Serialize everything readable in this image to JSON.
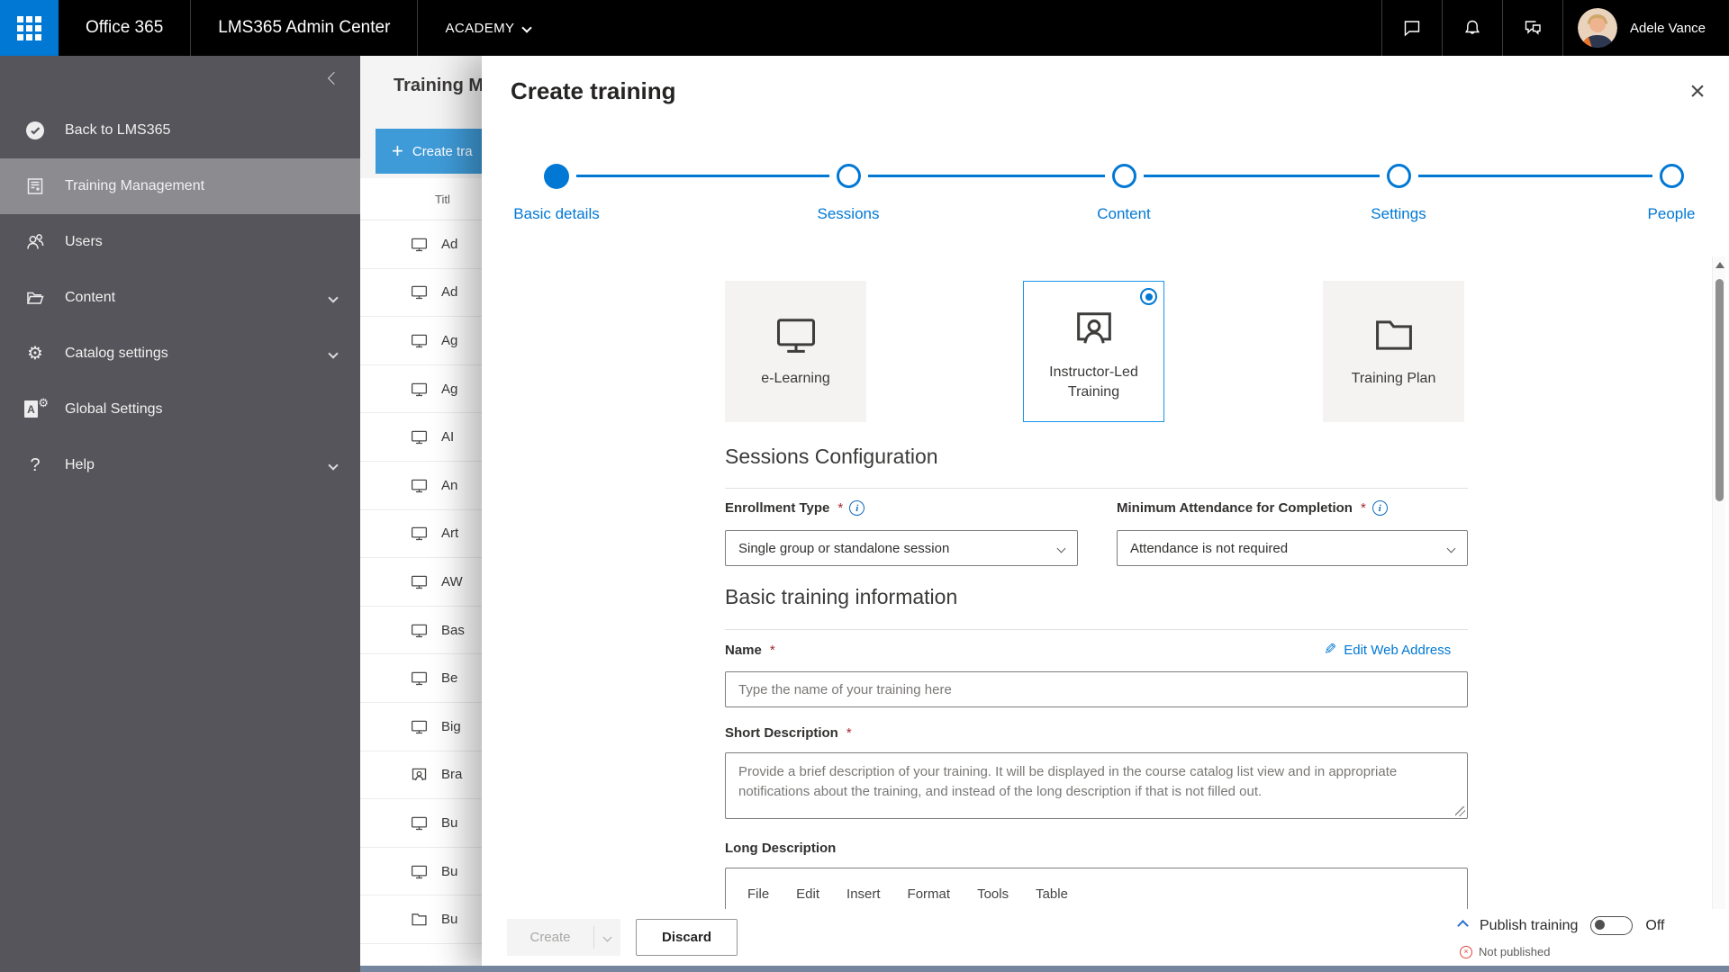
{
  "topbar": {
    "office365": "Office 365",
    "admin_center": "LMS365 Admin Center",
    "tenant": "ACADEMY",
    "user_name": "Adele Vance"
  },
  "sidebar": {
    "items": [
      {
        "label": "Back to LMS365",
        "icon": "check-circle",
        "selected": false,
        "expandable": false
      },
      {
        "label": "Training Management",
        "icon": "training-doc",
        "selected": true,
        "expandable": false
      },
      {
        "label": "Users",
        "icon": "users",
        "selected": false,
        "expandable": false
      },
      {
        "label": "Content",
        "icon": "folder",
        "selected": false,
        "expandable": true
      },
      {
        "label": "Catalog settings",
        "icon": "gear",
        "selected": false,
        "expandable": true
      },
      {
        "label": "Global Settings",
        "icon": "global-settings",
        "selected": false,
        "expandable": false
      },
      {
        "label": "Help",
        "icon": "question",
        "selected": false,
        "expandable": true
      }
    ]
  },
  "list_panel": {
    "title_fragment": "Training M",
    "create_button_fragment": "Create tra",
    "column_header_fragment": "Titl",
    "rows": [
      {
        "label": "Ad",
        "icon": "e-learning"
      },
      {
        "label": "Ad",
        "icon": "e-learning"
      },
      {
        "label": "Ag",
        "icon": "e-learning"
      },
      {
        "label": "Ag",
        "icon": "e-learning"
      },
      {
        "label": "AI",
        "icon": "e-learning"
      },
      {
        "label": "An",
        "icon": "e-learning"
      },
      {
        "label": "Art",
        "icon": "e-learning"
      },
      {
        "label": "AW",
        "icon": "e-learning"
      },
      {
        "label": "Bas",
        "icon": "e-learning"
      },
      {
        "label": "Be",
        "icon": "e-learning"
      },
      {
        "label": "Big",
        "icon": "e-learning"
      },
      {
        "label": "Bra",
        "icon": "instructor-led"
      },
      {
        "label": "Bu",
        "icon": "e-learning"
      },
      {
        "label": "Bu",
        "icon": "e-learning"
      },
      {
        "label": "Bu",
        "icon": "training-plan"
      }
    ]
  },
  "modal": {
    "title": "Create training",
    "steps": [
      {
        "label": "Basic details",
        "state": "active"
      },
      {
        "label": "Sessions",
        "state": "upcoming"
      },
      {
        "label": "Content",
        "state": "upcoming"
      },
      {
        "label": "Settings",
        "state": "upcoming"
      },
      {
        "label": "People",
        "state": "upcoming"
      }
    ],
    "training_types": [
      {
        "label": "e-Learning",
        "icon": "monitor",
        "selected": false
      },
      {
        "label": "Instructor-Led Training",
        "icon": "instructor",
        "selected": true
      },
      {
        "label": "Training Plan",
        "icon": "folder",
        "selected": false
      }
    ],
    "sessions_config": {
      "heading": "Sessions Configuration",
      "enrollment_label": "Enrollment Type",
      "enrollment_value": "Single group or standalone session",
      "attendance_label": "Minimum Attendance for Completion",
      "attendance_value": "Attendance is not required"
    },
    "basic_info": {
      "heading": "Basic training information",
      "name_label": "Name",
      "edit_web_address": "Edit Web Address",
      "name_placeholder": "Type the name of your training here",
      "short_desc_label": "Short Description",
      "short_desc_placeholder": "Provide a brief description of your training. It will be displayed in the course catalog list view and in appropriate notifications about the training, and instead of the long description if that is not filled out.",
      "long_desc_label": "Long Description",
      "editor_menu": [
        "File",
        "Edit",
        "Insert",
        "Format",
        "Tools",
        "Table"
      ]
    },
    "footer": {
      "create_label": "Create",
      "discard_label": "Discard",
      "publish_label": "Publish training",
      "toggle_state": "Off",
      "status": "Not published"
    }
  },
  "colors": {
    "accent": "#0078d4",
    "topbar_bg": "#000000",
    "sidebar_bg": "#55555b",
    "sidebar_selected": "#8b8b90",
    "list_button_blue": "#3f9bd8",
    "required_red": "#a4262c",
    "status_red": "#e04a3f",
    "bottom_strip": "#75879f",
    "card_bg": "#f4f3f1"
  }
}
